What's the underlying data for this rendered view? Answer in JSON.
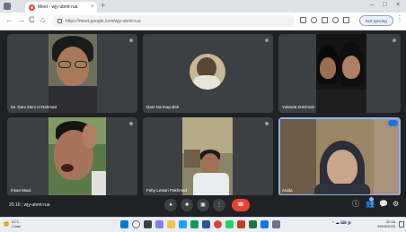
{
  "browser": {
    "tab_title": "Meet - wjy-ubmt-rua",
    "tab_close": "×",
    "new_tab": "+",
    "window_controls": [
      "–",
      "□",
      "×"
    ],
    "nav": [
      "←",
      "→",
      "C",
      "⌂"
    ],
    "url": "https://meet.google.com/wjy-ubmt-rua",
    "profile_label": "Not syncing",
    "menu": "⋮"
  },
  "meet": {
    "participants": [
      {
        "name": "Mr. Dani Zaini Al Rahmad"
      },
      {
        "name": "Dani Nurmayudah"
      },
      {
        "name": "Yolanda Zukrimah"
      },
      {
        "name": "Ihsan Maul"
      },
      {
        "name": "Feby Lestari Pakhmad"
      },
      {
        "name": "Anida"
      }
    ],
    "meeting_time": "20.16",
    "meeting_code": "wjy-ubmt-rua",
    "controls": {
      "mic": "●",
      "camera": "■",
      "captions": "▣",
      "present": "⬆",
      "more": "⋮",
      "end": "☎"
    },
    "right_controls": [
      "ⓘ",
      "👥",
      "💬",
      "⚙"
    ]
  },
  "taskbar": {
    "weather_temp": "31°C",
    "weather_desc": "Cerah",
    "tray": "^  ☁  ⌨  🔊",
    "time": "20.16",
    "date": "19/03/2022"
  },
  "colors": {
    "meet_background": "#202124",
    "tile_background": "#3c4043",
    "end_call": "#ea4335",
    "speaking_outline": "#8ab4f8"
  }
}
